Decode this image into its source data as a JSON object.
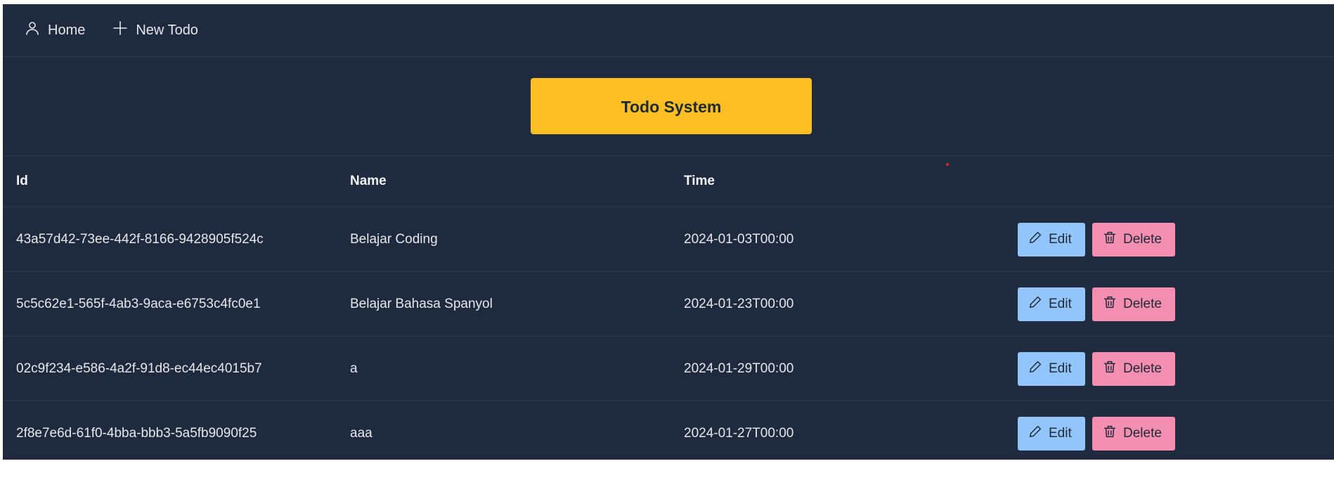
{
  "nav": {
    "home_label": "Home",
    "new_todo_label": "New Todo"
  },
  "title_button": {
    "label": "Todo System"
  },
  "table": {
    "headers": [
      "Id",
      "Name",
      "Time",
      ""
    ],
    "rows": [
      {
        "id": "43a57d42-73ee-442f-8166-9428905f524c",
        "name": "Belajar Coding",
        "time": "2024-01-03T00:00"
      },
      {
        "id": "5c5c62e1-565f-4ab3-9aca-e6753c4fc0e1",
        "name": "Belajar Bahasa Spanyol",
        "time": "2024-01-23T00:00"
      },
      {
        "id": "02c9f234-e586-4a2f-91d8-ec44ec4015b7",
        "name": "a",
        "time": "2024-01-29T00:00"
      },
      {
        "id": "2f8e7e6d-61f0-4bba-bbb3-5a5fb9090f25",
        "name": "aaa",
        "time": "2024-01-27T00:00"
      }
    ],
    "edit_label": "Edit",
    "delete_label": "Delete"
  },
  "colors": {
    "background": "#1f2a3f",
    "title_accent": "#fbbf24",
    "edit_button": "#93c5fd",
    "delete_button": "#f48fb1"
  },
  "icons": {
    "home": "user-icon",
    "new_todo": "plus-icon",
    "edit": "pencil-icon",
    "delete": "trash-icon"
  }
}
